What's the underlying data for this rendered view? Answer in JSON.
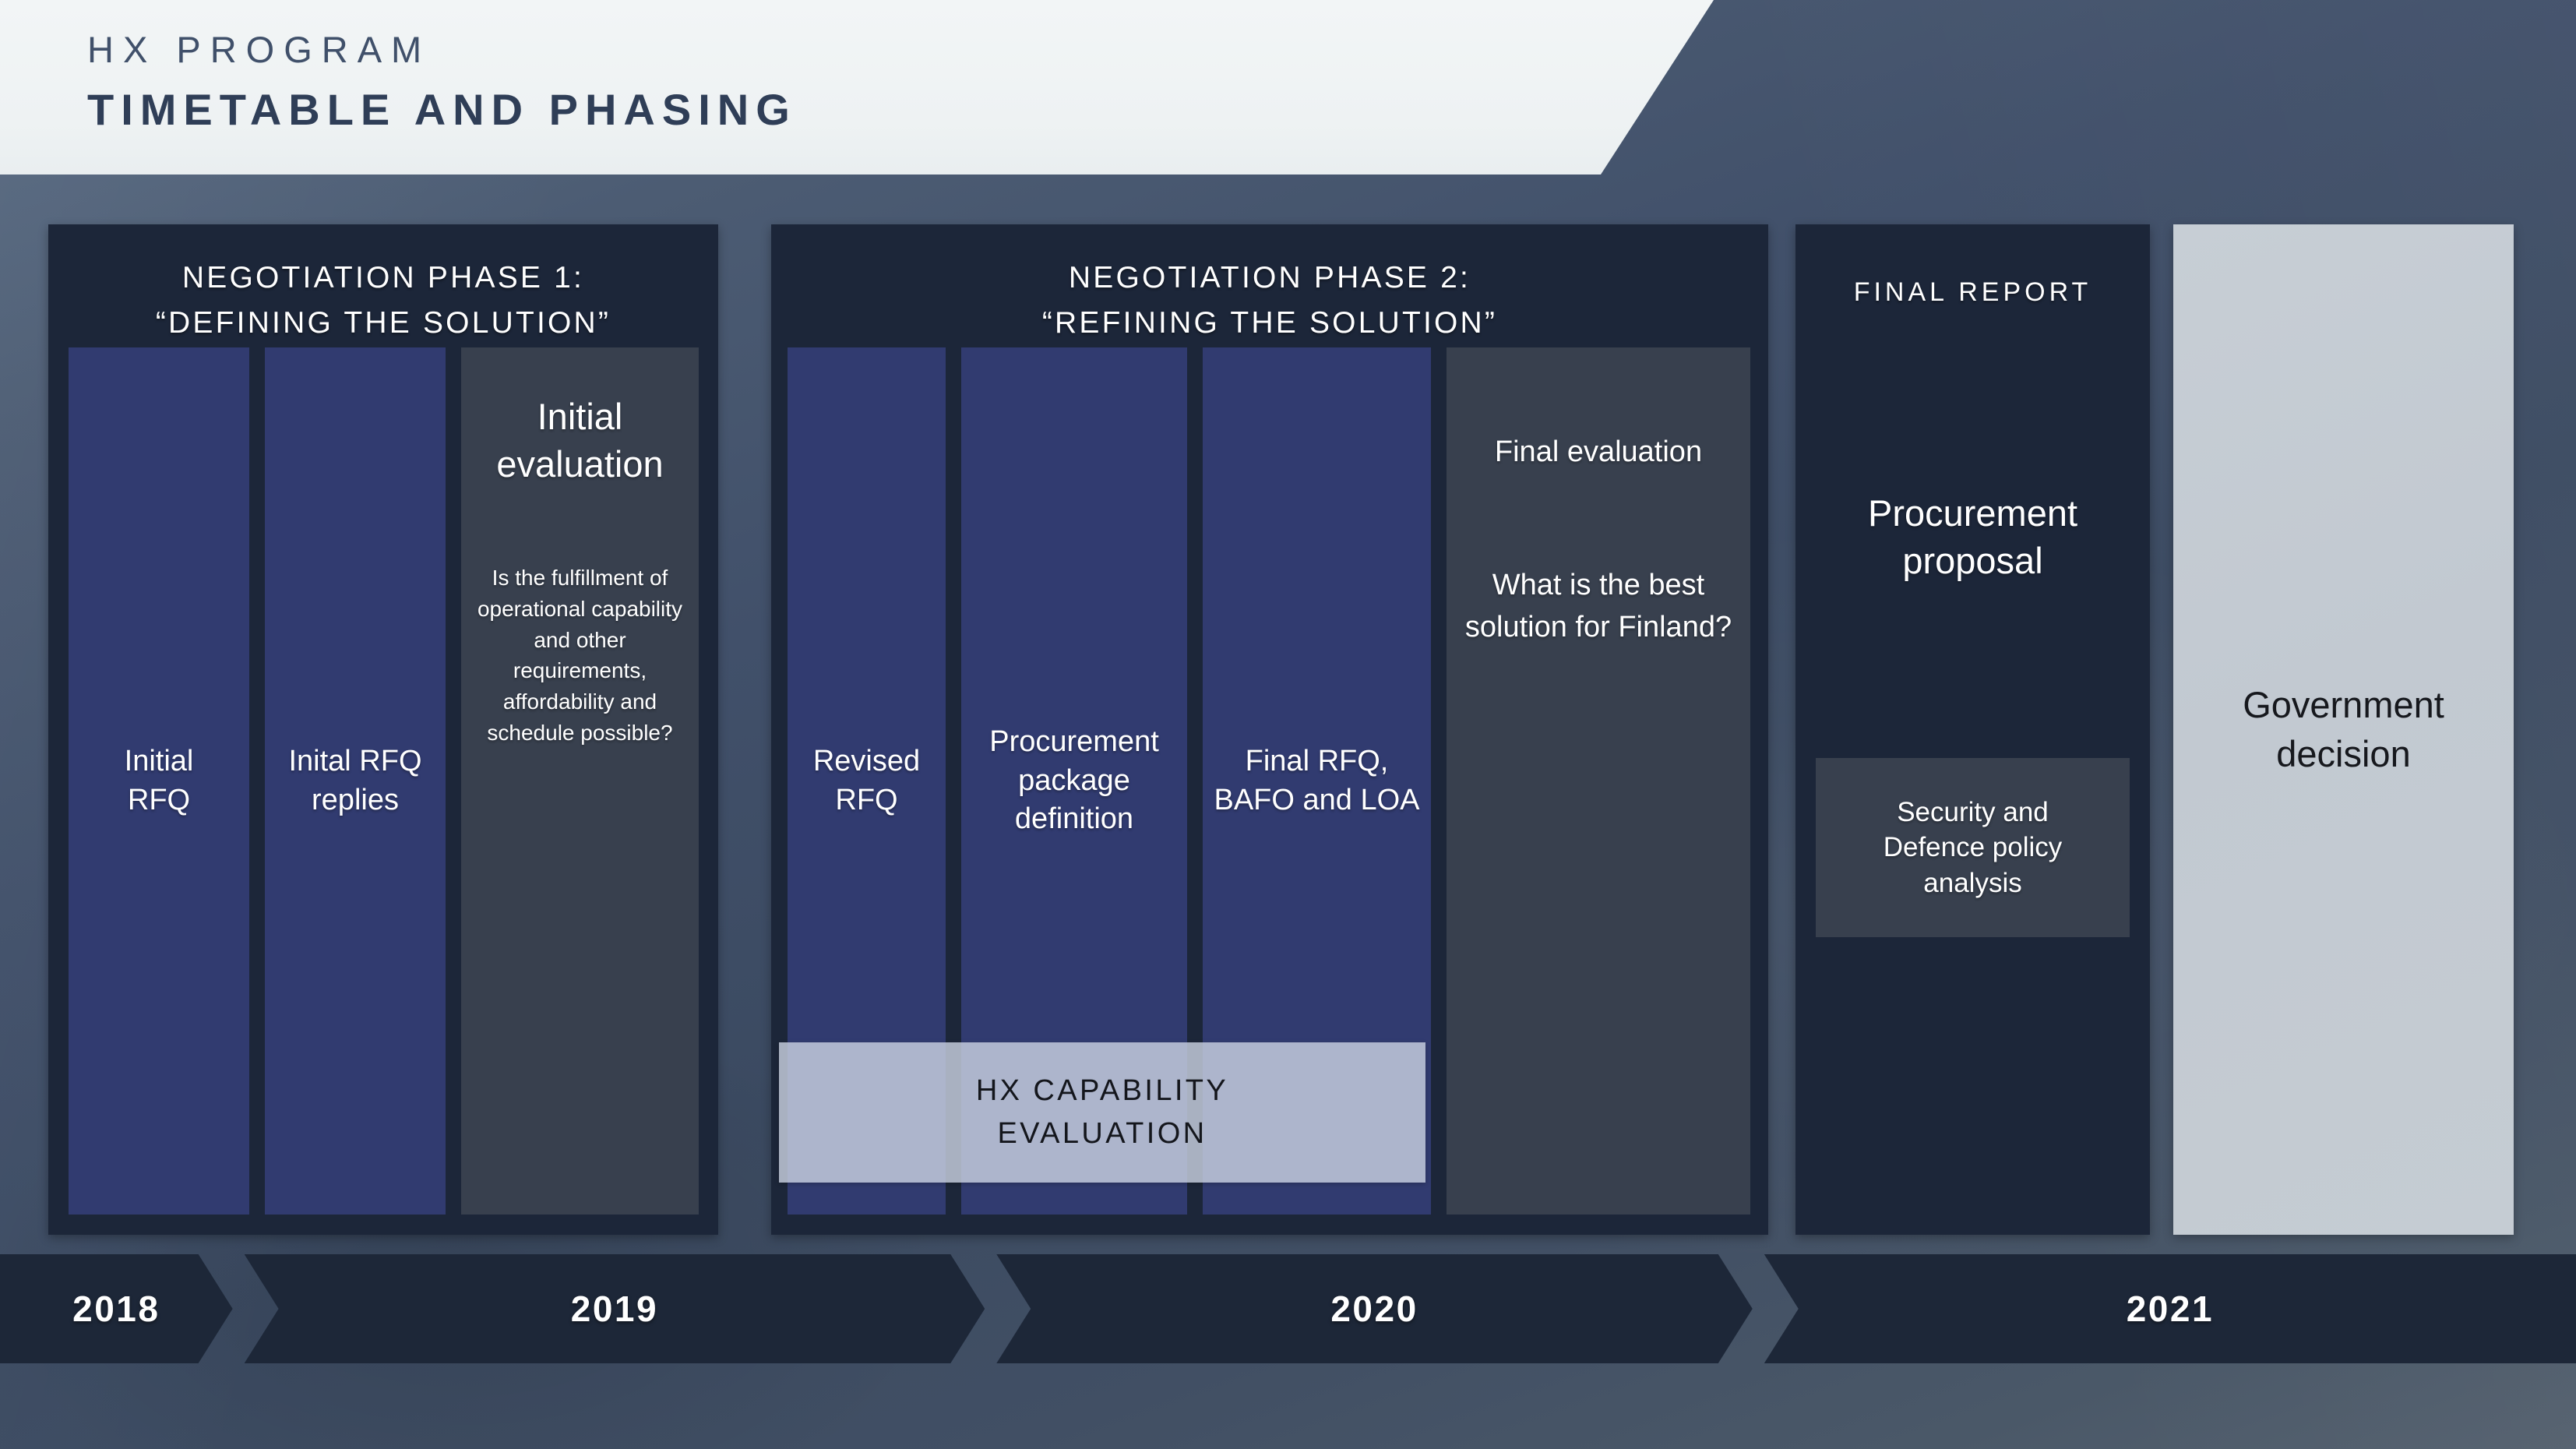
{
  "header": {
    "eyebrow": "HX PROGRAM",
    "title": "TIMETABLE AND PHASING"
  },
  "phase1": {
    "title": "NEGOTIATION PHASE 1:\n“DEFINING THE SOLUTION”",
    "columns": [
      {
        "label": "Initial\nRFQ",
        "style": "blue"
      },
      {
        "label": "Inital RFQ\nreplies",
        "style": "blue"
      },
      {
        "label": "Initial\nevaluation",
        "body": "Is the fulfillment of operational capability and other requirements, affordability and schedule possible?",
        "style": "slate"
      }
    ]
  },
  "phase2": {
    "title": "NEGOTIATION PHASE 2:\n“REFINING THE SOLUTION”",
    "columns": [
      {
        "label": "Revised\nRFQ",
        "style": "blue"
      },
      {
        "label": "Procurement\npackage\ndefinition",
        "style": "blue"
      },
      {
        "label": "Final RFQ,\nBAFO and LOA",
        "style": "blue"
      },
      {
        "label": "Final evaluation",
        "body": "What is the best solution for Finland?",
        "style": "slate"
      }
    ],
    "capability_band": "HX CAPABILITY\nEVALUATION"
  },
  "final_report": {
    "title": "FINAL REPORT",
    "proposal": "Procurement\nproposal",
    "security_box": "Security and\nDefence policy\nanalysis"
  },
  "government": {
    "label": "Government\ndecision"
  },
  "timeline": {
    "years": [
      "2018",
      "2019",
      "2020",
      "2021"
    ]
  },
  "colors": {
    "background_dark": "#3f4e63",
    "panel_dark": "#1c2639",
    "column_blue": "#313b70",
    "column_slate": "#38404e",
    "header_light": "#f0f4f5",
    "government_panel": "#c5ccd3",
    "capability_band": "#cdd4e4",
    "timeline_segment": "#1d2738",
    "text_light": "#ffffff",
    "text_dark": "#2f3e57"
  }
}
